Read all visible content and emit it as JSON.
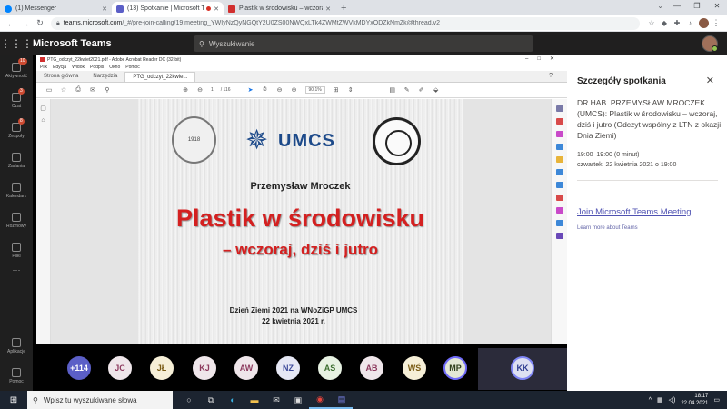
{
  "browser": {
    "tabs": [
      {
        "label": "(1) Messenger",
        "favicon_color": "#0084ff"
      },
      {
        "label": "(13) Spotkanie | Microsoft Te",
        "favicon_color": "#5b5fc7"
      },
      {
        "label": "Plastik w środowisku – wczoraj, d",
        "favicon_color": "#d12f2f"
      }
    ],
    "new_tab_icon": "plus-icon",
    "url_host": "teams.microsoft.com",
    "url_path": "/_#/pre-join-calling/19:meeting_YWIyNzQyNGQtY2U0ZS00NWQxLTk4ZWMtZWVkMDYxODZkNmZk@thread.v2"
  },
  "teams": {
    "app_title": "Microsoft Teams",
    "search_placeholder": "Wyszukiwanie",
    "rail": [
      {
        "label": "Aktywność",
        "badge": "10"
      },
      {
        "label": "Czat",
        "badge": "3"
      },
      {
        "label": "Zespoły",
        "badge": "8"
      },
      {
        "label": "Zadania",
        "badge": ""
      },
      {
        "label": "Kalendarz",
        "badge": ""
      },
      {
        "label": "Rozmowy",
        "badge": ""
      },
      {
        "label": "Pliki",
        "badge": ""
      }
    ],
    "rail_more": "···",
    "rail_bottom": [
      {
        "label": "Aplikacje"
      },
      {
        "label": "Pomoc"
      }
    ]
  },
  "acrobat": {
    "window_title": "PTG_odczyt_22kwiet2021.pdf - Adobe Acrobat Reader DC (32-bit)",
    "menu": [
      "Plik",
      "Edycja",
      "Widok",
      "Podpis",
      "Okno",
      "Pomoc"
    ],
    "tabs": [
      "Strona główna",
      "Narzędzia",
      "PTG_odczyt_22kwie..."
    ],
    "page_current": "1",
    "page_total": "/ 116",
    "zoom": "90,1%"
  },
  "slide": {
    "seal_left_text": "1918",
    "logo_text": "UMCS",
    "author": "Przemysław Mroczek",
    "title": "Plastik w środowisku",
    "subtitle": "– wczoraj, dziś i jutro",
    "footer_line1": "Dzień Ziemi 2021 na WNoZiGP UMCS",
    "footer_line2": "22 kwietnia 2021 r."
  },
  "participants": {
    "more": "+114",
    "people": [
      "JC",
      "JŁ",
      "KJ",
      "AW",
      "NZ",
      "AS",
      "AB",
      "WŚ",
      "MP"
    ],
    "self": "KK"
  },
  "details": {
    "title": "Szczegóły spotkania",
    "description": "DR HAB. PRZEMYSŁAW MROCZEK (UMCS): Plastik w środowisku – wczoraj, dziś i jutro (Odczyt wspólny z LTN z okazji Dnia Ziemi)",
    "time": "19:00–19:00 (0 minut)",
    "date": "czwartek, 22 kwietnia 2021 o 19:00",
    "join_link": "Join Microsoft Teams Meeting",
    "learn_more": "Learn more about Teams"
  },
  "taskbar": {
    "search_placeholder": "Wpisz tu wyszukiwane słowa",
    "time": "18:17",
    "date": "22.04.2021"
  },
  "colors": {
    "teams_purple": "#5b5fc7",
    "title_red": "#d42020",
    "umcs_blue": "#1d4a8a"
  }
}
